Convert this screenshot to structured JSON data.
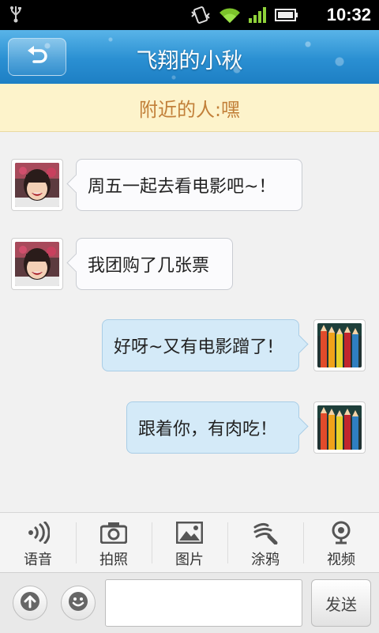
{
  "status_bar": {
    "time": "10:32"
  },
  "header": {
    "title": "飞翔的小秋"
  },
  "banner": {
    "text": "附近的人:嘿"
  },
  "messages": [
    {
      "side": "in",
      "text": "周五一起去看电影吧~！"
    },
    {
      "side": "in",
      "text": "我团购了几张票"
    },
    {
      "side": "out",
      "text": "好呀~又有电影蹭了!"
    },
    {
      "side": "out",
      "text": "跟着你，有肉吃！"
    }
  ],
  "toolbar": {
    "voice": "语音",
    "photo": "拍照",
    "image": "图片",
    "doodle": "涂鸦",
    "video": "视频"
  },
  "input_bar": {
    "text_value": "",
    "send_label": "发送"
  },
  "colors": {
    "header": "#2a8fd2",
    "banner_bg": "#fdf3cb",
    "banner_text": "#c2803a",
    "bubble_out": "#d4eaf8"
  }
}
